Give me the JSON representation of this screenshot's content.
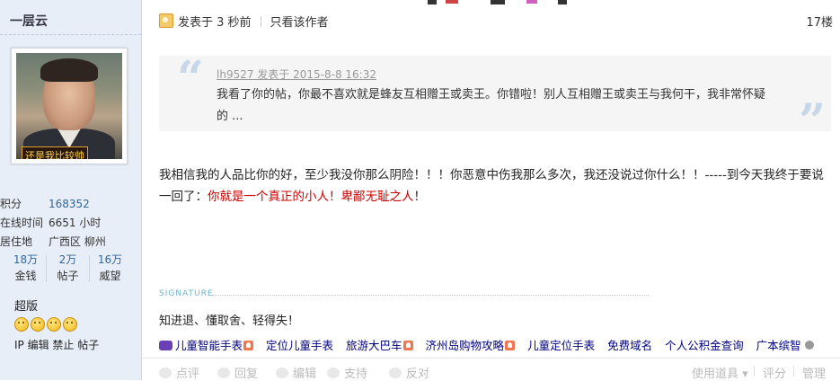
{
  "author": {
    "username": "一层云",
    "avatar_caption": "还是我比较帅",
    "stats": [
      {
        "label": "积分",
        "value": "168352"
      },
      {
        "label": "在线时间",
        "value": "6651 小时"
      },
      {
        "label": "居住地",
        "value": "广西区 柳州"
      }
    ],
    "mini_stats": [
      {
        "num": "18万",
        "label": "金钱"
      },
      {
        "num": "2万",
        "label": "帖子"
      },
      {
        "num": "16万",
        "label": "威望"
      }
    ],
    "rank": "超版",
    "ip_links": "IP 编辑 禁止 帖子"
  },
  "post": {
    "posted_at": "发表于 3 秒前",
    "only_author": "只看该作者",
    "floor": "17楼",
    "quote": {
      "author": "lh9527 发表于 2015-8-8 16:32",
      "text": "我看了你的帖，你最不喜欢就是蜂友互相赠王或卖王。你错啦！别人互相赠王或卖王与我何干，我非常怀疑的 ..."
    },
    "message_part1": "我相信我的人品比你的好，至少我没你那么阴险！！！你恶意中伤我那么多次，我还没说过你什么！！-----到今天我终于要说一回了：",
    "message_red": "你就是一个真正的小人！卑鄙无耻之人",
    "message_end": "！",
    "signature_label": "SIGNATURE",
    "signature": "知进退、懂取舍、轻得失！"
  },
  "ads": [
    "儿童智能手表",
    "定位儿童手表",
    "旅游大巴车",
    "济州岛购物攻略",
    "儿童定位手表",
    "免费域名",
    "个人公积金查询",
    "广本缤智"
  ],
  "actions": {
    "rate": "点评",
    "reply": "回复",
    "edit": "编辑",
    "support": "支持",
    "oppose": "反对",
    "tools": "使用道具",
    "score": "评分",
    "manage": "管理"
  }
}
